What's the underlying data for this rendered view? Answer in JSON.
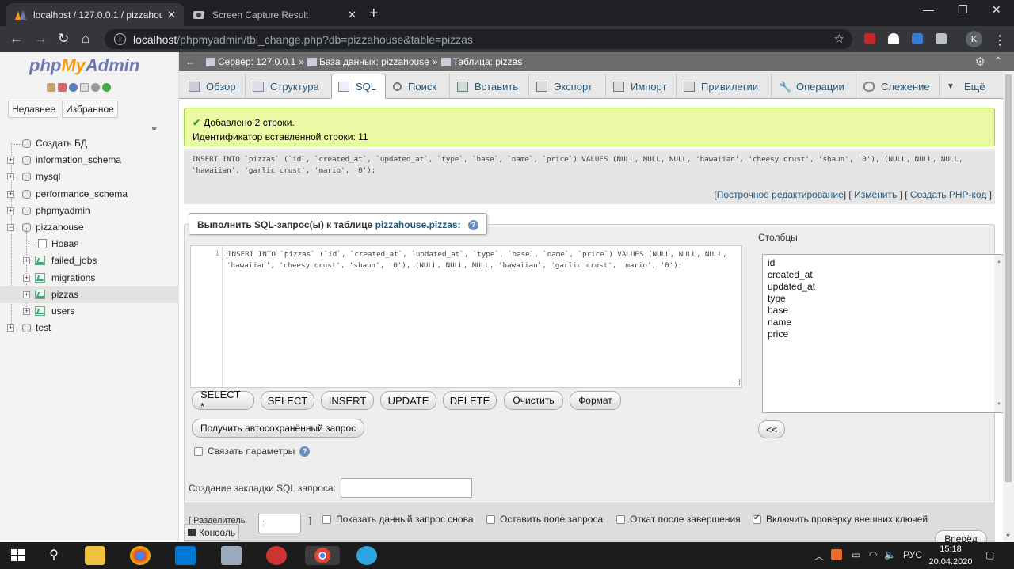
{
  "browser": {
    "tabs": [
      {
        "title": "localhost / 127.0.0.1 / pizzahouse",
        "active": true
      },
      {
        "title": "Screen Capture Result",
        "active": false
      }
    ],
    "address": {
      "host": "localhost",
      "path": "/phpmyadmin/tbl_change.php?db=pizzahouse&table=pizzas"
    },
    "profile_initial": "K"
  },
  "logo": {
    "php": "php",
    "my": "My",
    "admin": "Admin"
  },
  "nav": {
    "recent": "Недавнее",
    "favorites": "Избранное",
    "tree": {
      "create_db": "Создать БД",
      "databases": [
        "information_schema",
        "mysql",
        "performance_schema",
        "phpmyadmin",
        "pizzahouse"
      ],
      "pizzahouse_children": {
        "new": "Новая",
        "tables": [
          "failed_jobs",
          "migrations",
          "pizzas",
          "users"
        ]
      },
      "last_db": "test"
    }
  },
  "breadcrumb": {
    "server": "Сервер: 127.0.0.1",
    "database": "База данных: pizzahouse",
    "table": "Таблица: pizzas"
  },
  "menu": {
    "tabs": [
      "Обзор",
      "Структура",
      "SQL",
      "Поиск",
      "Вставить",
      "Экспорт",
      "Импорт",
      "Привилегии",
      "Операции",
      "Слежение",
      "Ещё"
    ],
    "active": "SQL"
  },
  "message": {
    "line1": "Добавлено 2 строки.",
    "line2": "Идентификатор вставленной строки: 11"
  },
  "query_echo": {
    "line1": "INSERT INTO `pizzas` (`id`, `created_at`, `updated_at`, `type`, `base`, `name`, `price`) VALUES (NULL, NULL, NULL, 'hawaiian', 'cheesy crust', 'shaun', '0'), (NULL, NULL, NULL,",
    "line2": "'hawaiian', 'garlic crust', 'mario', '0');"
  },
  "query_links": {
    "inline": "Построчное редактирование",
    "edit": "Изменить",
    "php": "Создать PHP-код"
  },
  "sql_form": {
    "legend_prefix": "Выполнить SQL-запрос(ы) к таблице",
    "legend_target": "pizzahouse.pizzas:",
    "line_number": "1",
    "code_line1": "INSERT INTO `pizzas` (`id`, `created_at`, `updated_at`, `type`, `base`, `name`, `price`) VALUES (NULL, NULL, NULL,",
    "code_line2": "'hawaiian', 'cheesy crust', 'shaun', '0'), (NULL, NULL, NULL, 'hawaiian', 'garlic crust', 'mario', '0');",
    "buttons": [
      "SELECT *",
      "SELECT",
      "INSERT",
      "UPDATE",
      "DELETE",
      "Очистить",
      "Формат"
    ],
    "autosave": "Получить автосохранённый запрос",
    "bind_params": "Связать параметры",
    "bookmark_label": "Создание закладки SQL запроса:",
    "columns_label": "Столбцы",
    "columns": [
      "id",
      "created_at",
      "updated_at",
      "type",
      "base",
      "name",
      "price"
    ],
    "insert_col": "<<"
  },
  "options": {
    "delimiter_label": "[ Разделитель",
    "delimiter_value": ";",
    "delimiter_close": "]",
    "show_again": "Показать данный запрос снова",
    "keep_box": "Оставить поле запроса",
    "rollback": "Откат после завершения",
    "fk_checks": "Включить проверку внешних ключей",
    "go": "Вперёд"
  },
  "console": "Консоль",
  "taskbar": {
    "lang": "РУС",
    "time": "15:18",
    "date": "20.04.2020"
  }
}
